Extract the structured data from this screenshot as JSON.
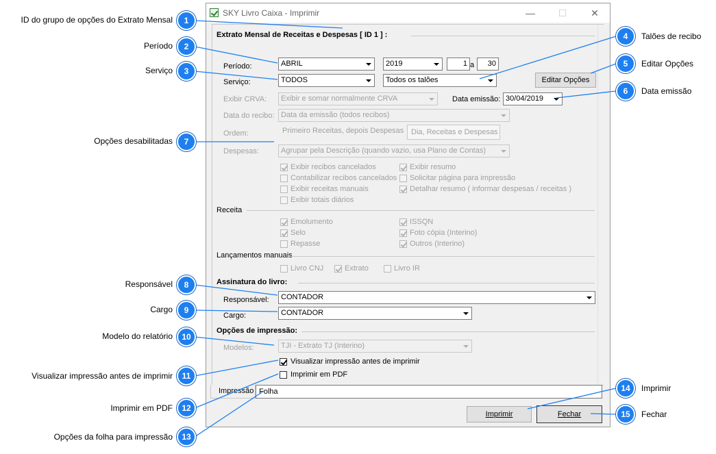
{
  "window": {
    "title": "SKY Livro Caixa - Imprimir",
    "min_glyph": "—",
    "max_glyph": "☐",
    "close_glyph": "✕"
  },
  "extrato": {
    "section_title": "Extrato Mensal de Receitas e Despesas [ ID 1 ] :",
    "periodo_label": "Período:",
    "periodo_month": "ABRIL",
    "periodo_year": "2019",
    "periodo_from": "1",
    "periodo_a": "a",
    "periodo_to": "30",
    "servico_label": "Serviço:",
    "servico_value": "TODOS",
    "taloes_value": "Todos os talões",
    "editar_opcoes": "Editar Opções",
    "exibir_crva_label": "Exibir CRVA:",
    "exibir_crva_value": "Exibir e somar normalmente CRVA",
    "data_emissao_label": "Data emissão:",
    "data_emissao_value": "30/04/2019",
    "data_recibo_label": "Data do recibo:",
    "data_recibo_value": "Data da emissão (todos recibos)",
    "ordem_label": "Ordem:",
    "ordem_option1": "Primeiro Receitas, depois Despesas",
    "ordem_option2": "Dia, Receitas e Despesas",
    "despesas_label": "Despesas:",
    "despesas_value": "Agrupar pela Descrição (quando vazio, usa Plano de Contas)",
    "chk_exibir_recibos_cancelados": "Exibir recibos cancelados",
    "chk_contabilizar_recibos_cancelados": "Contabilizar recibos cancelados",
    "chk_exibir_receitas_manuais": "Exibir receitas manuais",
    "chk_exibir_totais_diarios": "Exibir totais diários",
    "chk_exibir_resumo": "Exibir resumo",
    "chk_solicitar_pagina": "Solicitar página para impressão",
    "chk_detalhar_resumo": "Detalhar resumo ( informar despesas / receitas )"
  },
  "receita": {
    "title": "Receita",
    "emolumento": "Emolumento",
    "selo": "Selo",
    "repasse": "Repasse",
    "issqn": "ISSQN",
    "foto_copia": "Foto cópia (Interino)",
    "outros": "Outros (Interino)"
  },
  "lancamentos": {
    "title": "Lançamentos manuais",
    "livro_cnj": "Livro CNJ",
    "extrato": "Extrato",
    "livro_ir": "Livro IR"
  },
  "assinatura": {
    "title": "Assinatura do livro:",
    "responsavel_label": "Responsável:",
    "responsavel_value": "CONTADOR",
    "cargo_label": "Cargo:",
    "cargo_value": "CONTADOR"
  },
  "impressao": {
    "title": "Opções de impressão:",
    "modelos_label": "Modelos:",
    "modelos_value": "TJI - Extrato TJ (Interino)",
    "visualizar": "Visualizar impressão antes de imprimir",
    "imprimir_pdf": "Imprimir em PDF"
  },
  "tabs": {
    "impressao": "Impressão",
    "folha": "Folha"
  },
  "buttons": {
    "imprimir": "Imprimir",
    "fechar": "Fechar"
  },
  "callouts": [
    {
      "n": "1",
      "label": "ID do grupo de opções do Extrato Mensal"
    },
    {
      "n": "2",
      "label": "Período"
    },
    {
      "n": "3",
      "label": "Serviço"
    },
    {
      "n": "4",
      "label": "Talões de recibo"
    },
    {
      "n": "5",
      "label": "Editar Opções"
    },
    {
      "n": "6",
      "label": "Data emissão"
    },
    {
      "n": "7",
      "label": "Opções desabilitadas"
    },
    {
      "n": "8",
      "label": "Responsável"
    },
    {
      "n": "9",
      "label": "Cargo"
    },
    {
      "n": "10",
      "label": "Modelo do relatório"
    },
    {
      "n": "11",
      "label": "Visualizar impressão antes de imprimir"
    },
    {
      "n": "12",
      "label": "Imprimir em PDF"
    },
    {
      "n": "13",
      "label": "Opções da folha para impressão"
    },
    {
      "n": "14",
      "label": "Imprimir"
    },
    {
      "n": "15",
      "label": "Fechar"
    }
  ],
  "colors": {
    "badge": "#1e7ff0",
    "focus_border": "#0078d7"
  }
}
